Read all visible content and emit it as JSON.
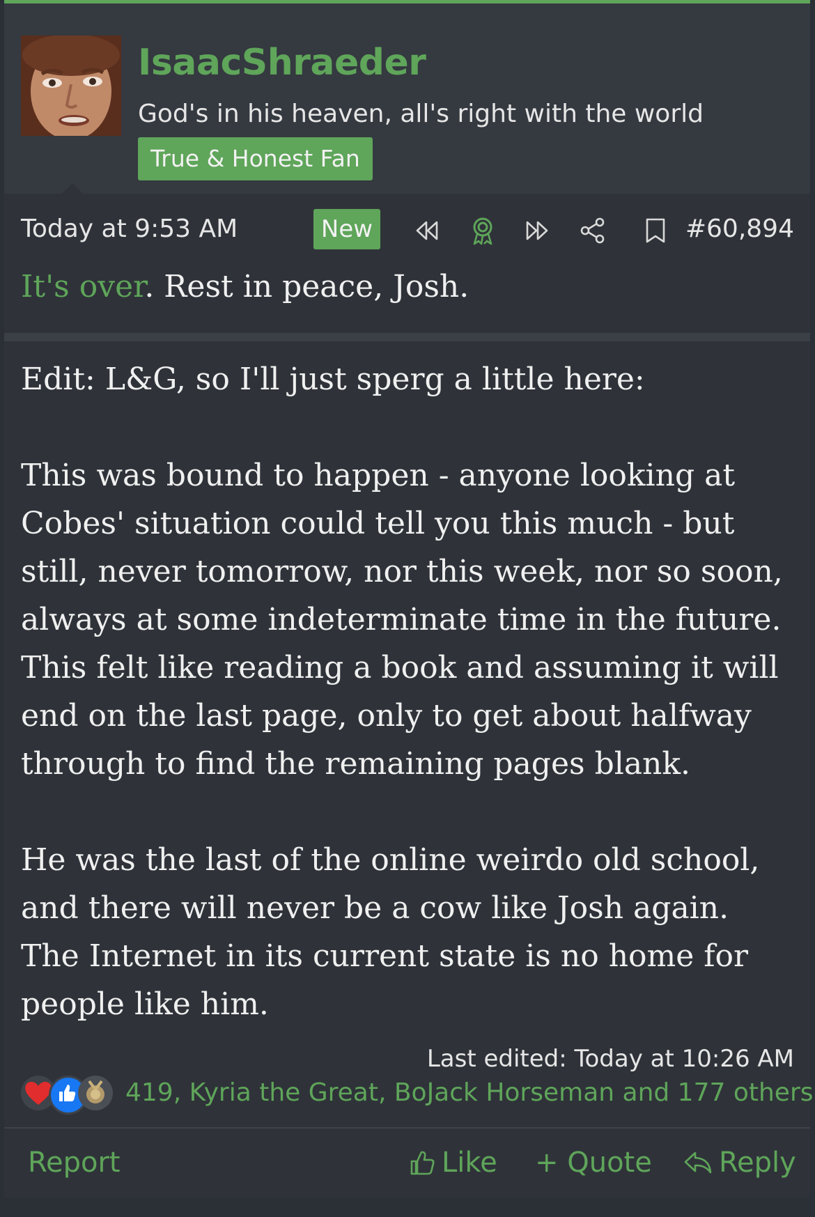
{
  "user": {
    "name": "IsaacShraeder",
    "title": "God's in his heaven, all's right with the world",
    "banner": "True & Honest Fan"
  },
  "post": {
    "time": "Today at 9:53 AM",
    "new_badge": "New",
    "number": "#60,894",
    "lead_link": "It's over",
    "lead_rest": ". Rest in peace, Josh.",
    "paragraphs": [
      "Edit: L&G, so I'll just sperg a little here:",
      "This was bound to happen - anyone looking at Cobes' situation could tell you this much - but still, never tomorrow, nor this week, nor so soon, always at some indeterminate time in the future. This felt like reading a book and assuming it will end on the last page, only to get about halfway through to find the remaining pages blank.",
      "He was the last of the online weirdo old school, and there will never be a cow like Josh again. The Internet in its current state is no home for people like him."
    ],
    "last_edited": "Last edited: Today at 10:26 AM",
    "reactions_text": "419, Kyria the Great, BoJack Horseman and 177 others"
  },
  "actions": {
    "report": "Report",
    "like": "Like",
    "quote": "+ Quote",
    "reply": "Reply"
  },
  "icons": {
    "rewind": "rewind-icon",
    "award": "award-icon",
    "forward": "fast-forward-icon",
    "share": "share-icon",
    "bookmark": "bookmark-icon",
    "like": "thumbs-up-icon",
    "reply": "reply-icon"
  },
  "colors": {
    "accent": "#5fa55a",
    "background": "#2f3339",
    "text": "#f0f0f0"
  }
}
